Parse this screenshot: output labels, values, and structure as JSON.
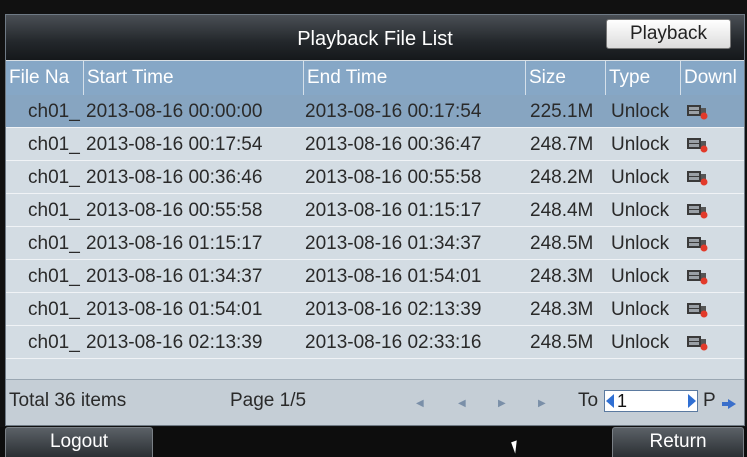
{
  "window": {
    "title": "Playback File List",
    "playback_button": "Playback"
  },
  "table": {
    "columns": [
      "File Na",
      "Start Time",
      "End Time",
      "Size",
      "Type",
      "Downl"
    ],
    "rows": [
      {
        "file": "ch01_",
        "start": "2013-08-16 00:00:00",
        "end": "2013-08-16 00:17:54",
        "size": "225.1M",
        "type": "Unlock",
        "download_icon": "download-icon",
        "selected": true
      },
      {
        "file": "ch01_",
        "start": "2013-08-16 00:17:54",
        "end": "2013-08-16 00:36:47",
        "size": "248.7M",
        "type": "Unlock",
        "download_icon": "download-icon",
        "selected": false
      },
      {
        "file": "ch01_",
        "start": "2013-08-16 00:36:46",
        "end": "2013-08-16 00:55:58",
        "size": "248.2M",
        "type": "Unlock",
        "download_icon": "download-icon",
        "selected": false
      },
      {
        "file": "ch01_",
        "start": "2013-08-16 00:55:58",
        "end": "2013-08-16 01:15:17",
        "size": "248.4M",
        "type": "Unlock",
        "download_icon": "download-icon",
        "selected": false
      },
      {
        "file": "ch01_",
        "start": "2013-08-16 01:15:17",
        "end": "2013-08-16 01:34:37",
        "size": "248.5M",
        "type": "Unlock",
        "download_icon": "download-icon",
        "selected": false
      },
      {
        "file": "ch01_",
        "start": "2013-08-16 01:34:37",
        "end": "2013-08-16 01:54:01",
        "size": "248.3M",
        "type": "Unlock",
        "download_icon": "download-icon",
        "selected": false
      },
      {
        "file": "ch01_",
        "start": "2013-08-16 01:54:01",
        "end": "2013-08-16 02:13:39",
        "size": "248.3M",
        "type": "Unlock",
        "download_icon": "download-icon",
        "selected": false
      },
      {
        "file": "ch01_",
        "start": "2013-08-16 02:13:39",
        "end": "2013-08-16 02:33:16",
        "size": "248.5M",
        "type": "Unlock",
        "download_icon": "download-icon",
        "selected": false
      }
    ]
  },
  "footer": {
    "total": "Total 36 items",
    "page": "Page 1/5",
    "to_label": "To",
    "to_value": "1",
    "page_suffix": "P",
    "nav_icons": [
      "first-page-icon",
      "prev-page-icon",
      "next-page-icon",
      "last-page-icon"
    ]
  },
  "bottom": {
    "logout": "Logout",
    "return": "Return"
  },
  "colors": {
    "selected_row": "#87a5c1",
    "header": "#86a7c6",
    "row": "#d3dce3"
  }
}
